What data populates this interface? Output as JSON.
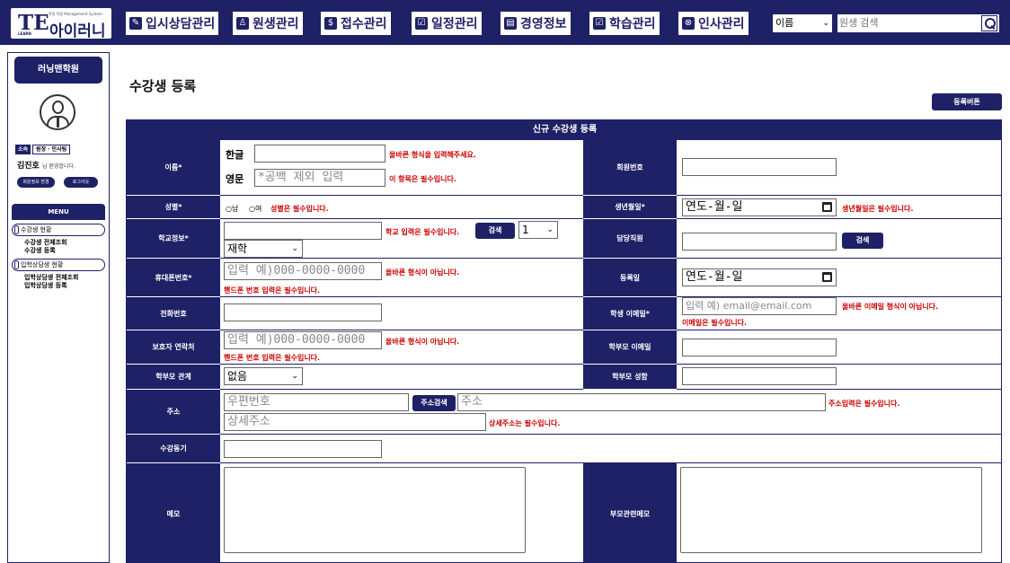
{
  "logo": {
    "te": "TE",
    "name": "아이러니",
    "sub": "학원 학원 Management System",
    "learn": "LEARN"
  },
  "nav": [
    {
      "icon": "✎",
      "label": "입시상담관리"
    },
    {
      "icon": "♙",
      "label": "원생관리"
    },
    {
      "icon": "$",
      "label": "접수관리"
    },
    {
      "icon": "☑",
      "label": "일정관리"
    },
    {
      "icon": "▤",
      "label": "경영정보"
    },
    {
      "icon": "☑",
      "label": "학습관리"
    },
    {
      "icon": "⊗",
      "label": "인사관리"
    }
  ],
  "search": {
    "select_value": "이름",
    "placeholder": "원생 검색"
  },
  "sidebar": {
    "org": "러닝맨학원",
    "role_tag": "소속",
    "role_value": "원장 · 인사팀",
    "greeting_name": "김진호",
    "greeting_suffix": "님 환영합니다.",
    "btn_info": "회원정보 변경",
    "btn_logout": "로그아웃",
    "menu_title": "MENU",
    "groups": [
      {
        "label": "수강생 현황",
        "items": [
          "수강생 전체조회",
          "수강생 등록"
        ]
      },
      {
        "label": "입학상담생 현황",
        "items": [
          "입학상담생 전체조회",
          "입학상담생 등록"
        ]
      }
    ]
  },
  "page": {
    "title": "수강생 등록",
    "register_button": "등록버튼",
    "form_title": "신규 수강생 등록"
  },
  "form": {
    "name_label": "이름*",
    "name_korean": "한글",
    "name_english": "영문",
    "name_english_placeholder": "*공백 제외 입력",
    "name_error1": "올바른 형식을 입력해주세요.",
    "name_error2": "이 항목은 필수입니다.",
    "member_no_label": "회원번호",
    "gender_label": "성별*",
    "gender_male": "○남",
    "gender_female": "○여",
    "gender_error": "성별은 필수입니다.",
    "birth_label": "생년월일*",
    "birth_value": "연도-월-일",
    "birth_error": "생년월일은 필수입니다.",
    "school_label": "학교정보*",
    "school_error": "학교 입력은 필수입니다.",
    "school_search": "검색",
    "grade_value": "1",
    "status_value": "재학",
    "teacher_label": "담당직원",
    "teacher_search": "검색",
    "phone_label": "휴대폰번호*",
    "phone_placeholder": "입력 예)000-0000-0000",
    "phone_error1": "올바른 형식이 아닙니다.",
    "phone_error2": "핸드폰 번호 입력은 필수입니다.",
    "reg_date_label": "등록일",
    "reg_date_value": "연도-월-일",
    "tel_label": "전화번호",
    "email_label": "학생 이메일*",
    "email_placeholder": "입력 예) email@email.com",
    "email_error1": "올바른 이메일 형식이 아닙니다.",
    "email_error2": "이메일은 필수입니다.",
    "guardian_label": "보호자 연락처",
    "guardian_placeholder": "입력 예)000-0000-0000",
    "guardian_error1": "올바른 형식이 아닙니다.",
    "guardian_error2": "핸드폰 번호 입력은 필수입니다.",
    "parent_email_label": "학부모 이메일",
    "relation_label": "학부모 관계",
    "relation_value": "없음",
    "parent_name_label": "학부모 성함",
    "address_label": "주소",
    "zip_placeholder": "우편번호",
    "address_search": "주소검색",
    "address_placeholder": "주소",
    "address_error": "주소입력은 필수입니다.",
    "detail_placeholder": "상세주소",
    "detail_error": "상세주소는 필수입니다.",
    "motive_label": "수강동기",
    "memo_label": "메모",
    "parent_memo_label": "부모관련메모"
  }
}
